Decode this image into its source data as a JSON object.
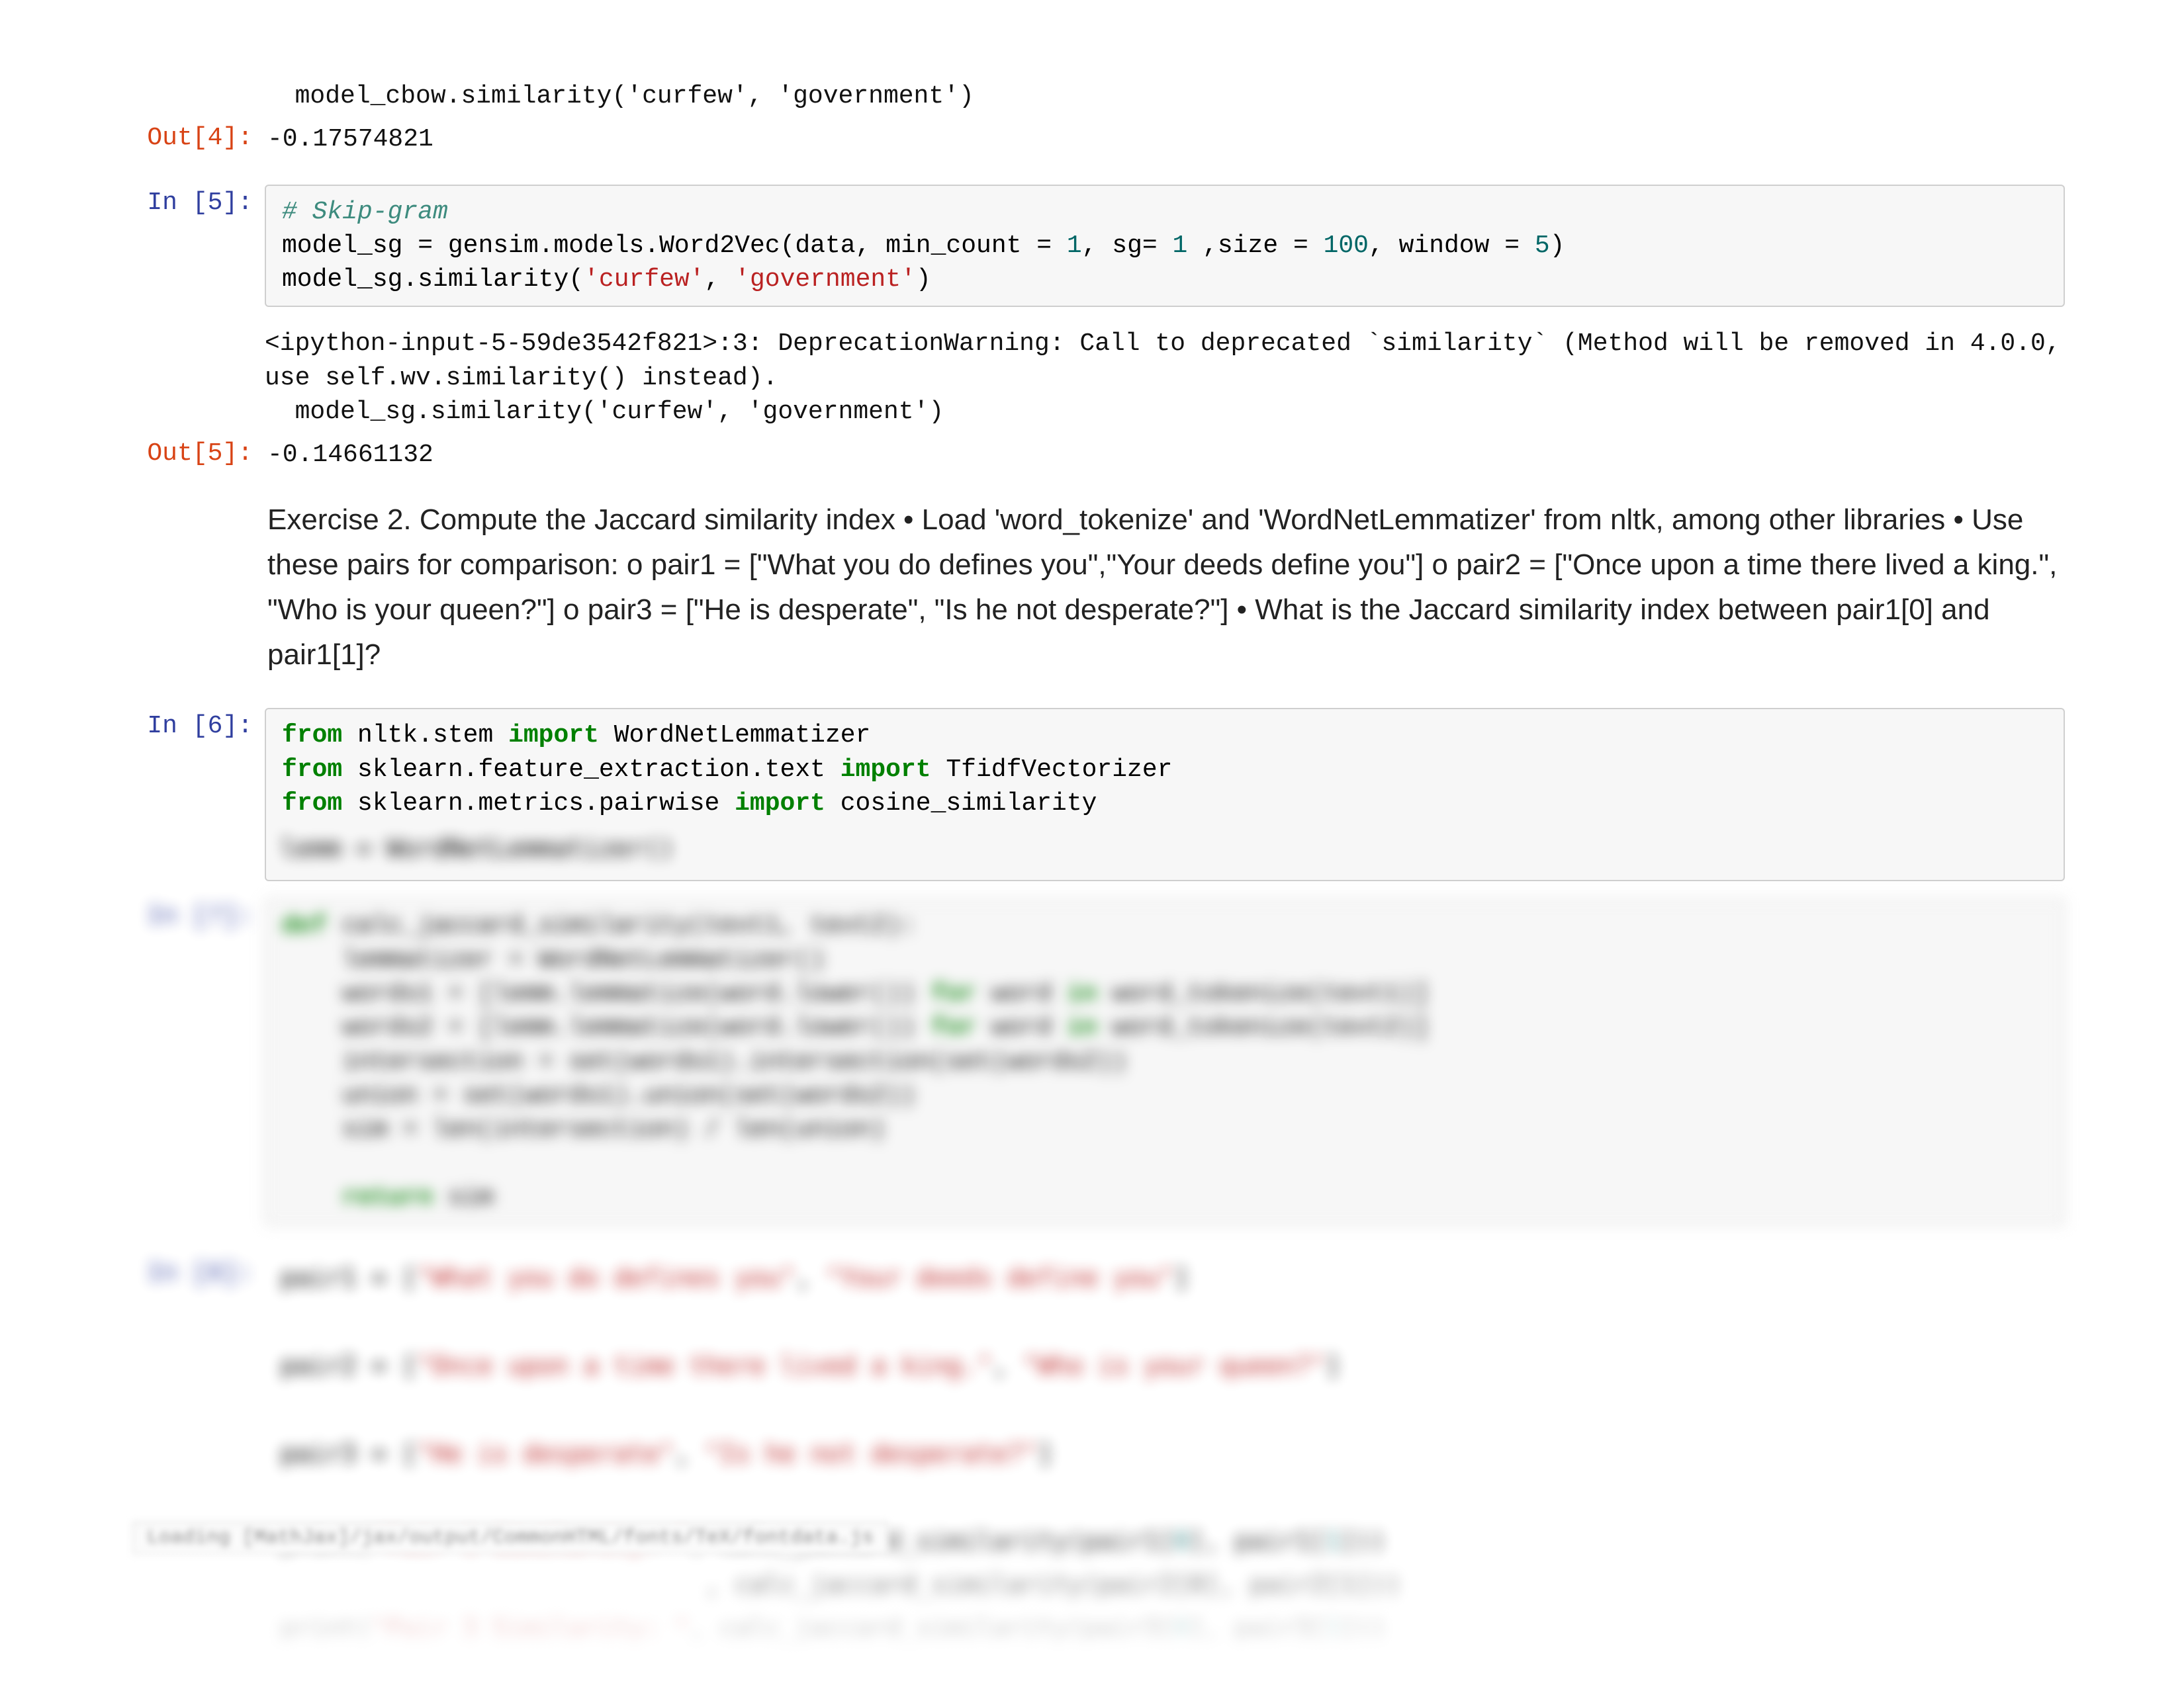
{
  "cells": {
    "out4_line": "  model_cbow.similarity('curfew', 'government')",
    "out4_prompt": "Out[4]:",
    "out4_value": "-0.17574821",
    "in5_prompt": "In [5]:",
    "in5_code": {
      "l1_comment": "# Skip-gram",
      "l2_a": "model_sg ",
      "l2_eq": "= ",
      "l2_b": "gensim",
      "l2_dot1": ".",
      "l2_c": "models",
      "l2_dot2": ".",
      "l2_d": "Word2Vec",
      "l2_open": "(",
      "l2_e": "data",
      "l2_com1": ", ",
      "l2_f": "min_count ",
      "l2_eq2": "= ",
      "l2_n1": "1",
      "l2_com2": ", ",
      "l2_g": "sg",
      "l2_eq3": "= ",
      "l2_n2": "1 ",
      "l2_com3": ",",
      "l2_h": "size ",
      "l2_eq4": "= ",
      "l2_n3": "100",
      "l2_com4": ", ",
      "l2_i": "window ",
      "l2_eq5": "= ",
      "l2_n4": "5",
      "l2_close": ")",
      "l3_a": "model_sg",
      "l3_dot": ".",
      "l3_b": "similarity",
      "l3_open": "(",
      "l3_s1": "'curfew'",
      "l3_com": ", ",
      "l3_s2": "'government'",
      "l3_close": ")"
    },
    "warn5": "<ipython-input-5-59de3542f821>:3: DeprecationWarning: Call to deprecated `similarity` (Method will be removed in 4.0.0, use self.wv.similarity() instead).\n  model_sg.similarity('curfew', 'government')",
    "out5_prompt": "Out[5]:",
    "out5_value": "-0.14661132",
    "markdown": "Exercise 2. Compute the Jaccard similarity index • Load 'word_tokenize' and 'WordNetLemmatizer' from nltk, among other libraries • Use these pairs for comparison: o pair1 = [\"What you do defines you\",\"Your deeds define you\"] o pair2 = [\"Once upon a time there lived a king.\", \"Who is your queen?\"] o pair3 = [\"He is desperate\", \"Is he not desperate?\"] • What is the Jaccard similarity index between pair1[0] and pair1[1]?",
    "in6_prompt": "In [6]:",
    "in6_code": {
      "l1_from": "from",
      "l1_mod": " nltk.stem ",
      "l1_import": "import",
      "l1_names": " WordNetLemmatizer",
      "l2_from": "from",
      "l2_mod": " sklearn.feature_extraction.text ",
      "l2_import": "import",
      "l2_names": " TfidfVectorizer",
      "l3_from": "from",
      "l3_mod": " sklearn.metrics.pairwise ",
      "l3_import": "import",
      "l3_names": " cosine_similarity",
      "l5_a": "lemm ",
      "l5_eq": "= ",
      "l5_b": "WordNetLemmatizer",
      "l5_par": "()"
    },
    "in7_prompt": "In [7]:",
    "in7": {
      "def": "def",
      "fname": " calc_jaccard_similarity(text1, text2):",
      "b1_a": "    lemmatizer ",
      "b1_eq": "= ",
      "b1_b": "WordNetLemmatizer",
      "b1_par": "()",
      "b2_a": "    words1 ",
      "b2_eq": "= [",
      "b2_b": "lemm.lemmatize(word.lower()) ",
      "b2_for": "for",
      "b2_c": " word ",
      "b2_in": "in",
      "b2_d": " word_tokenize(text1)",
      "b2_close": "]",
      "b3_a": "    words2 ",
      "b3_eq": "= [",
      "b3_b": "lemm.lemmatize(word.lower()) ",
      "b3_for": "for",
      "b3_c": " word ",
      "b3_in": "in",
      "b3_d": " word_tokenize(text2)",
      "b3_close": "]",
      "b4": "    intersection = set(words1).intersection(set(words2))",
      "b5": "    union = set(words1).union(set(words2))",
      "b6": "    sim = len(intersection) / len(union)",
      "ret_kw": "return",
      "ret_v": " sim"
    },
    "in8_prompt": "In [8]:",
    "in8": {
      "p1_a": "pair1 ",
      "p1_eq": "= [",
      "p1_s1": "\"What you do defines you\"",
      "p1_com": ", ",
      "p1_s2": "\"Your deeds define you\"",
      "p1_close": "]",
      "p2_a": "pair2 ",
      "p2_eq": "= [",
      "p2_s1": "\"Once upon a time there lived a king.\"",
      "p2_com": ", ",
      "p2_s2": "\"Who is your queen?\"",
      "p2_close": "]",
      "p3_a": "pair3 ",
      "p3_eq": "= [",
      "p3_s1": "\"He is desperate\"",
      "p3_com": ", ",
      "p3_s2": "\"Is he not desperate?\"",
      "p3_close": "]",
      "pr_a": "print(",
      "pr_s": "\"Pair 1 Similarity: \"",
      "pr_b": ", calc_jaccard_similarity(pair1[",
      "pr_n0": "0",
      "pr_c": "], pair1[",
      "pr_n1": "1",
      "pr_d": "]))",
      "pr2": "                            , calc_jaccard_similarity(pair2[0], pair2[1]))",
      "pr3_a": "print(",
      "pr3_s": "\"Pair 3 Similarity: \"",
      "pr3_b": ", calc_jaccard_similarity(pair3[",
      "pr3_n0": "0",
      "pr3_c": "], pair3[",
      "pr3_n1": "1",
      "pr3_d": "]))"
    },
    "status": "Loading [MathJax]/jax/output/CommonHTML/fonts/TeX/fontdata.js"
  }
}
